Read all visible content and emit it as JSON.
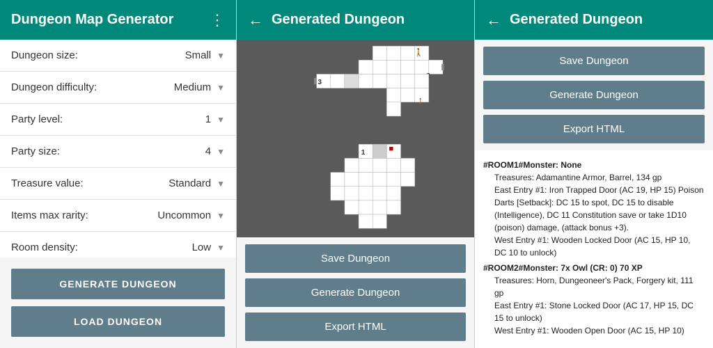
{
  "settings_panel": {
    "title": "Dungeon Map Generator",
    "menu_icon": "⋮",
    "settings": [
      {
        "label": "Dungeon size:",
        "value": "Small"
      },
      {
        "label": "Dungeon difficulty:",
        "value": "Medium"
      },
      {
        "label": "Party level:",
        "value": "1"
      },
      {
        "label": "Party size:",
        "value": "4"
      },
      {
        "label": "Treasure value:",
        "value": "Standard"
      },
      {
        "label": "Items max rarity:",
        "value": "Uncommon"
      },
      {
        "label": "Room density:",
        "value": "Low"
      }
    ],
    "btn_generate": "GENERATE DUNGEON",
    "btn_load": "LOAD DUNGEON"
  },
  "map_panel": {
    "back_arrow": "←",
    "title": "Generated Dungeon",
    "btn_save": "Save Dungeon",
    "btn_generate": "Generate Dungeon",
    "btn_export": "Export HTML"
  },
  "details_panel": {
    "back_arrow": "←",
    "title": "Generated Dungeon",
    "btn_save": "Save Dungeon",
    "btn_generate": "Generate Dungeon",
    "btn_export": "Export HTML",
    "rooms": [
      {
        "header": "#ROOM1#Monster: None",
        "lines": [
          "Treasures: Adamantine Armor, Barrel, 134 gp",
          "East Entry #1: Iron Trapped Door (AC 19, HP 15) Poison Darts [Setback]: DC 15 to spot, DC 15 to disable (Intelligence), DC 11 Constitution save or take 1D10 (poison) damage, (attack bonus +3).",
          "West Entry #1: Wooden Locked Door (AC 15, HP 10, DC 10 to unlock)"
        ]
      },
      {
        "header": "#ROOM2#Monster: 7x Owl (CR: 0) 70 XP",
        "lines": [
          "Treasures: Horn, Dungeoneer's Pack, Forgery kit, 111 gp",
          "East Entry #1: Stone Locked Door (AC 17, HP 15, DC 15 to unlock)",
          "West Entry #1: Wooden Open Door (AC 15, HP 10)"
        ]
      }
    ]
  },
  "colors": {
    "teal": "#00897b",
    "slate": "#607d8b",
    "dark_bg": "#5a5a5a",
    "cell_white": "#ffffff",
    "cell_light": "#e8e8e8",
    "grid_line": "#999999"
  }
}
